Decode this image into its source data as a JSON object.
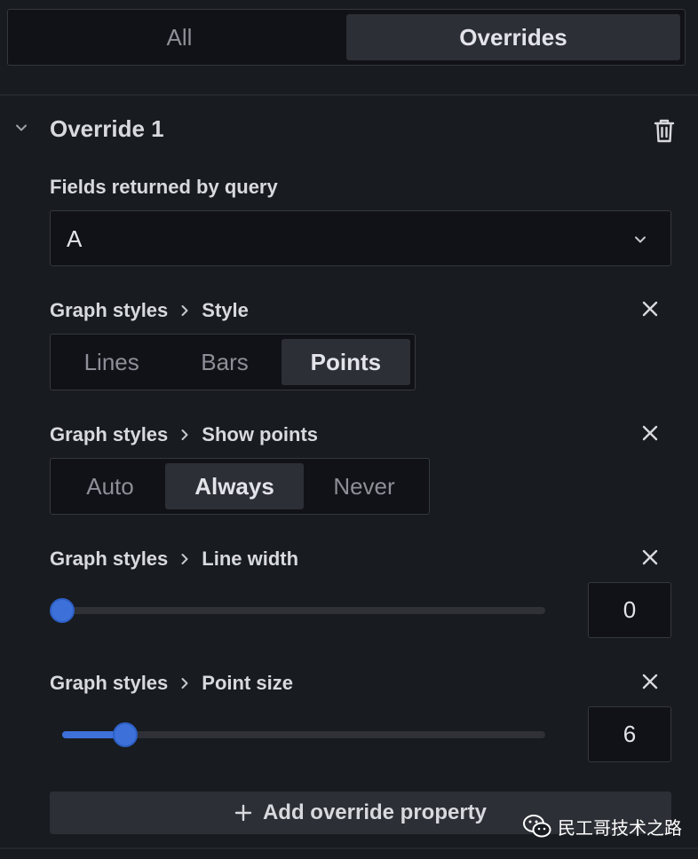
{
  "tabs": {
    "all_label": "All",
    "overrides_label": "Overrides",
    "active": "Overrides"
  },
  "override": {
    "title": "Override 1",
    "fields_label": "Fields returned by query",
    "fields_value": "A"
  },
  "properties": {
    "style": {
      "category": "Graph styles",
      "name": "Style",
      "options": [
        "Lines",
        "Bars",
        "Points"
      ],
      "selected": "Points"
    },
    "show_points": {
      "category": "Graph styles",
      "name": "Show points",
      "options": [
        "Auto",
        "Always",
        "Never"
      ],
      "selected": "Always"
    },
    "line_width": {
      "category": "Graph styles",
      "name": "Line width",
      "value": "0",
      "slider_fraction": 0
    },
    "point_size": {
      "category": "Graph styles",
      "name": "Point size",
      "value": "6",
      "slider_fraction": 0.13
    }
  },
  "add_button_label": "Add override property",
  "watermark": "民工哥技术之路",
  "colors": {
    "background": "#181b1f",
    "accent": "#3d71d9",
    "active_option": "#2c2f35"
  },
  "icons": {
    "collapse": "chevron-down-icon",
    "delete": "trash-icon",
    "remove": "close-icon",
    "breadcrumb": "chevron-right-icon",
    "add": "plus-icon",
    "watermark": "wechat-icon"
  }
}
